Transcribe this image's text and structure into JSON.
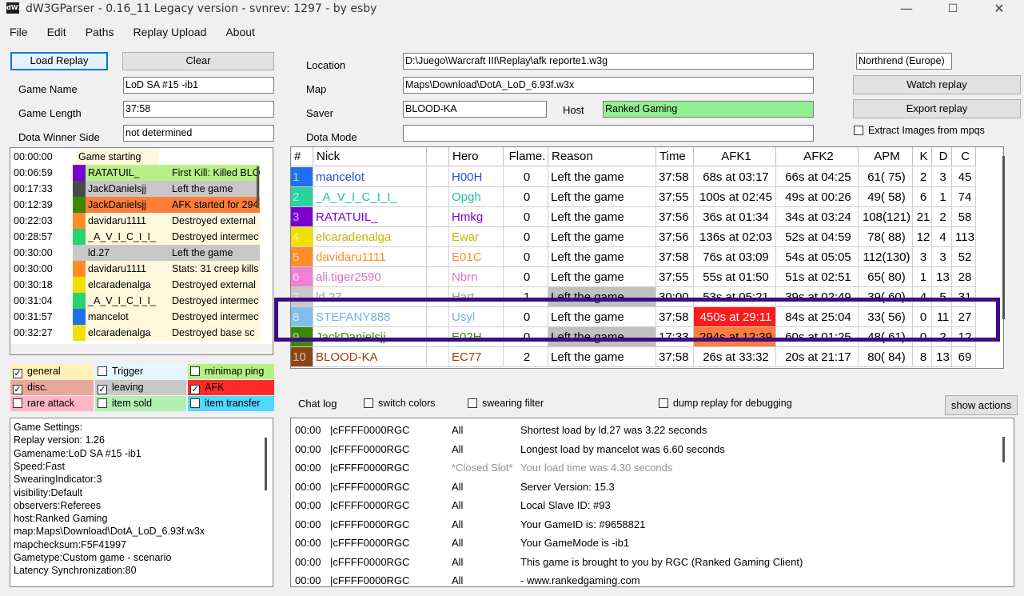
{
  "window": {
    "app_icon_text": "dW3G",
    "title": "dW3GParser - 0.16_11 Legacy version - svnrev: 1297 - by esby",
    "minimize_glyph": "—",
    "maximize_glyph": "☐",
    "close_glyph": "✕"
  },
  "menu": [
    "File",
    "Edit",
    "Paths",
    "Replay Upload",
    "About"
  ],
  "top_left": {
    "load_replay": "Load Replay",
    "clear": "Clear",
    "game_name_label": "Game Name",
    "game_name": "LoD SA #15 -ib1",
    "game_length_label": "Game Length",
    "game_length": "37:58",
    "winner_label": "Dota Winner Side",
    "winner": "not determined"
  },
  "top_right": {
    "location_label": "Location",
    "location": "D:\\Juego\\Warcraft III\\Replay\\afk reporte1.w3g",
    "map_label": "Map",
    "map": "Maps\\Download\\DotA_LoD_6.93f.w3x",
    "saver_label": "Saver",
    "saver": "BLOOD-KA",
    "host_label": "Host",
    "host": "Ranked Gaming",
    "dota_mode_label": "Dota Mode",
    "dota_mode": "",
    "realm": "Northrend (Europe)",
    "watch_replay": "Watch replay",
    "export_replay": "Export replay",
    "extract_images": "Extract Images from mpqs"
  },
  "events": [
    {
      "time": "00:00:00",
      "color": "",
      "nick": "Game starting",
      "desc": "",
      "bg": "#fff7dc"
    },
    {
      "time": "00:06:59",
      "color": "#7b00d0",
      "nick": "RATATUIL_",
      "desc": "First Kill: Killed BLO",
      "bg": "#b8f088"
    },
    {
      "time": "00:17:33",
      "color": "#4a4a4a",
      "nick": "JackDanielsjj",
      "desc": "Left the game",
      "bg": "#c8c8c8"
    },
    {
      "time": "00:12:39",
      "color": "#3a8a00",
      "nick": "JackDanielsjj",
      "desc": "AFK started for 294",
      "bg": "#ff7d3c"
    },
    {
      "time": "00:22:03",
      "color": "#ff8c28",
      "nick": "davidaru1111",
      "desc": "Destroyed external",
      "bg": "#fff7dc"
    },
    {
      "time": "00:28:57",
      "color": "#28d46e",
      "nick": "_A_V_I_C_I_I_",
      "desc": "Destroyed intermec",
      "bg": "#fff7dc"
    },
    {
      "time": "00:30:00",
      "color": "#c8c8c8",
      "nick": "ld.27",
      "desc": "Left the game",
      "bg": "#c8c8c8"
    },
    {
      "time": "00:30:00",
      "color": "#ff8c28",
      "nick": "davidaru1111",
      "desc": "Stats: 31 creep kills",
      "bg": "#fff7dc"
    },
    {
      "time": "00:30:18",
      "color": "#f0e000",
      "nick": "elcaradenalga",
      "desc": "Destroyed external",
      "bg": "#fff7dc"
    },
    {
      "time": "00:31:04",
      "color": "#28d46e",
      "nick": "_A_V_I_C_I_I_",
      "desc": "Destroyed intermec",
      "bg": "#fff7dc"
    },
    {
      "time": "00:31:57",
      "color": "#1f6ff0",
      "nick": "mancelot",
      "desc": "Destroyed intermec",
      "bg": "#fff7dc"
    },
    {
      "time": "00:32:27",
      "color": "#f0e000",
      "nick": "elcaradenalga",
      "desc": "Destroyed base sc",
      "bg": "#fff7dc"
    }
  ],
  "filters": [
    {
      "label": "general",
      "checked": true,
      "bg": "#fff2b8"
    },
    {
      "label": "Trigger",
      "checked": false,
      "bg": "#e6f6ff"
    },
    {
      "label": "minimap ping",
      "checked": false,
      "bg": "#b4f084"
    },
    {
      "label": "disc.",
      "checked": true,
      "bg": "#e8a898"
    },
    {
      "label": "leaving",
      "checked": true,
      "bg": "#c8c8c8"
    },
    {
      "label": "AFK",
      "checked": true,
      "bg": "#ff2a2a"
    },
    {
      "label": "rare attack",
      "checked": false,
      "bg": "#ffb4c8"
    },
    {
      "label": "item sold",
      "checked": false,
      "bg": "#b0f0b0"
    },
    {
      "label": "item transfer",
      "checked": false,
      "bg": "#50d8ff"
    }
  ],
  "settings_lines": [
    "Game Settings:",
    "Replay version: 1.26",
    "Gamename:LoD SA #15 -ib1",
    "Speed:Fast",
    "SwearingIndicator:3",
    "visibility:Default",
    "observers:Referees",
    "host:Ranked Gaming",
    "map:Maps\\Download\\DotA_LoD_6.93f.w3x",
    "mapchecksum:F5F41997",
    "Gametype:Custom game - scenario",
    "Latency Synchronization:80"
  ],
  "grid": {
    "headers": [
      "#",
      "Nick",
      "",
      "Hero",
      "Flame.",
      "Reason",
      "Time",
      "AFK1",
      "AFK2",
      "APM",
      "K",
      "D",
      "C"
    ],
    "rows": [
      {
        "num": "1",
        "numbg": "#1f6ff0",
        "nick": "mancelot",
        "nickcolor": "#1f4fd8",
        "hero": "H00H",
        "flame": "0",
        "reason": "Left the game",
        "time": "37:58",
        "afk1": "68s at 03:17",
        "afk2": "66s at 04:25",
        "apm": "61( 75)",
        "k": "2",
        "d": "3",
        "c": "45"
      },
      {
        "num": "2",
        "numbg": "#28d4a0",
        "nick": "_A_V_I_C_I_I_",
        "nickcolor": "#20c0a0",
        "hero": "Opgh",
        "flame": "0",
        "reason": "Left the game",
        "time": "37:55",
        "afk1": "100s at 02:45",
        "afk2": "49s at 00:26",
        "apm": "49( 58)",
        "k": "6",
        "d": "1",
        "c": "74"
      },
      {
        "num": "3",
        "numbg": "#7b00d0",
        "nick": "RATATUIL_",
        "nickcolor": "#7b00d0",
        "hero": "Hmkg",
        "flame": "0",
        "reason": "Left the game",
        "time": "37:56",
        "afk1": "36s at 01:34",
        "afk2": "34s at 03:24",
        "apm": "108(121)",
        "k": "21",
        "d": "2",
        "c": "58"
      },
      {
        "num": "4",
        "numbg": "#f0e000",
        "nick": "elcaradenalga",
        "nickcolor": "#c8b400",
        "hero": "Ewar",
        "flame": "0",
        "reason": "Left the game",
        "time": "37:56",
        "afk1": "136s at 02:03",
        "afk2": "52s at 04:59",
        "apm": "78( 88)",
        "k": "12",
        "d": "4",
        "c": "113"
      },
      {
        "num": "5",
        "numbg": "#ff8c28",
        "nick": "davidaru1111",
        "nickcolor": "#ff8c28",
        "hero": "E01C",
        "flame": "0",
        "reason": "Left the game",
        "time": "37:58",
        "afk1": "76s at 03:09",
        "afk2": "54s at 05:05",
        "apm": "112(130)",
        "k": "3",
        "d": "3",
        "c": "52"
      },
      {
        "num": "6",
        "numbg": "#f080d0",
        "nick": "ali.tiger2590",
        "nickcolor": "#e070c8",
        "hero": "Nbrn",
        "flame": "0",
        "reason": "Left the game",
        "time": "37:55",
        "afk1": "55s at 01:50",
        "afk2": "51s at 02:51",
        "apm": "65( 80)",
        "k": "1",
        "d": "13",
        "c": "28"
      },
      {
        "num": "7",
        "numbg": "#c8c8c8",
        "nick": "ld.27",
        "nickcolor": "#a0a0a0",
        "hero": "Hart",
        "flame": "1",
        "reason": "Left the game",
        "time": "30:00",
        "afk1": "53s at 05:21",
        "afk2": "39s at 02:49",
        "apm": "39( 60)",
        "k": "4",
        "d": "5",
        "c": "31"
      },
      {
        "num": "8",
        "numbg": "#80c0e8",
        "nick": "STEFANY888",
        "nickcolor": "#70b0e0",
        "hero": "Usyl",
        "flame": "0",
        "reason": "Left the game",
        "time": "37:58",
        "afk1": "450s at 29:11",
        "afk2": "84s at 25:04",
        "apm": "33( 56)",
        "k": "0",
        "d": "11",
        "c": "27"
      },
      {
        "num": "9",
        "numbg": "#3a8a00",
        "nick": "JackDanielsjj",
        "nickcolor": "#3a8a00",
        "hero": "E02H",
        "flame": "0",
        "reason": "Left the game",
        "time": "17:33",
        "afk1": "294s at 12:39",
        "afk2": "60s at 01:25",
        "apm": "48( 61)",
        "k": "0",
        "d": "2",
        "c": "12"
      },
      {
        "num": "10",
        "numbg": "#8b4513",
        "nick": "BLOOD-KA",
        "nickcolor": "#a03a10",
        "hero": "EC77",
        "flame": "2",
        "reason": "Left the game",
        "time": "37:58",
        "afk1": "26s at 33:32",
        "afk2": "20s at 21:17",
        "apm": "80( 84)",
        "k": "8",
        "d": "13",
        "c": "69"
      }
    ]
  },
  "chat_controls": {
    "chat_log_label": "Chat log",
    "switch_colors": "switch colors",
    "swearing_filter": "swearing filter",
    "dump_replay": "dump replay for debugging",
    "show_actions": "show actions"
  },
  "chat": [
    {
      "time": "00:00",
      "who": "|cFFFF0000RGC",
      "to": "All",
      "msg": "Shortest load by ld.27 was 3.22 seconds",
      "grey": false
    },
    {
      "time": "00:00",
      "who": "|cFFFF0000RGC",
      "to": "All",
      "msg": "Longest load by mancelot was 6.60 seconds",
      "grey": false
    },
    {
      "time": "00:00",
      "who": "|cFFFF0000RGC",
      "to": "*Closed Slot*",
      "msg": "Your load time was 4.30 seconds",
      "grey": true
    },
    {
      "time": "00:00",
      "who": "|cFFFF0000RGC",
      "to": "All",
      "msg": "Server Version: 15.3",
      "grey": false
    },
    {
      "time": "00:00",
      "who": "|cFFFF0000RGC",
      "to": "All",
      "msg": "Local Slave ID: #93",
      "grey": false
    },
    {
      "time": "00:00",
      "who": "|cFFFF0000RGC",
      "to": "All",
      "msg": "Your GameID is: #9658821",
      "grey": false
    },
    {
      "time": "00:00",
      "who": "|cFFFF0000RGC",
      "to": "All",
      "msg": "Your GameMode is -ib1",
      "grey": false
    },
    {
      "time": "00:00",
      "who": "|cFFFF0000RGC",
      "to": "All",
      "msg": "This game is brought to you by RGC (Ranked Gaming Client)",
      "grey": false
    },
    {
      "time": "00:00",
      "who": "|cFFFF0000RGC",
      "to": "All",
      "msg": "- www.rankedgaming.com",
      "grey": false
    }
  ]
}
